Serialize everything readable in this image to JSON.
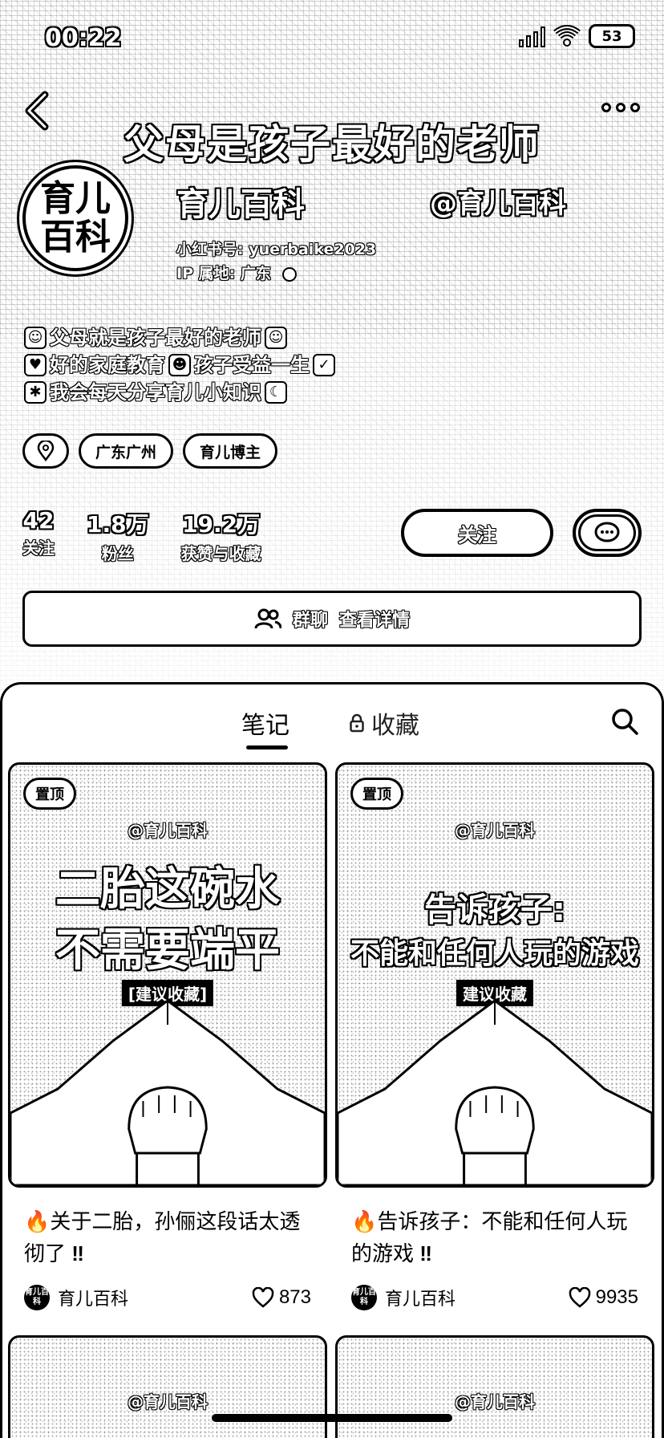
{
  "status": {
    "time": "00:22",
    "battery": "53"
  },
  "header": {
    "banner_title": "父母是孩子最好的老师",
    "avatar_line1": "育儿",
    "avatar_line2": "百科",
    "nickname": "育儿百科",
    "handle": "@育儿百科",
    "red_id": "小红书号: yuerbaike2023",
    "ip_location": "IP 属地: 广东"
  },
  "bio": {
    "line1": "父母就是孩子最好的老师",
    "line2_a": "好的家庭教育",
    "line2_b": "孩子受益一生",
    "line3": "我会每天分享育儿小知识"
  },
  "tags": [
    "广东广州",
    "育儿博主"
  ],
  "stats": [
    {
      "value": "42",
      "label": "关注"
    },
    {
      "value": "1.8万",
      "label": "粉丝"
    },
    {
      "value": "19.2万",
      "label": "获赞与收藏"
    }
  ],
  "actions": {
    "follow": "关注"
  },
  "group_bar": {
    "label": "群聊",
    "detail": "查看详情"
  },
  "tabs": {
    "notes": "笔记",
    "favorites": "收藏"
  },
  "notes": [
    {
      "pin": "置顶",
      "image_handle": "@育儿百科",
      "image_line1": "二胎这碗水",
      "image_line2": "不需要端平",
      "image_tag": "[建议收藏]",
      "title": "关于二胎，孙俪这段话太透彻了",
      "author": "育儿百科",
      "likes": "873"
    },
    {
      "pin": "置顶",
      "image_handle": "@育儿百科",
      "image_line1": "告诉孩子:",
      "image_line2": "不能和任何人玩的游戏",
      "image_tag": "建议收藏",
      "title": "告诉孩子：不能和任何人玩的游戏",
      "author": "育儿百科",
      "likes": "9935"
    },
    {
      "image_handle": "@育儿百科"
    },
    {
      "image_handle": "@育儿百科"
    }
  ],
  "mini_avatar_text": "育儿百科"
}
